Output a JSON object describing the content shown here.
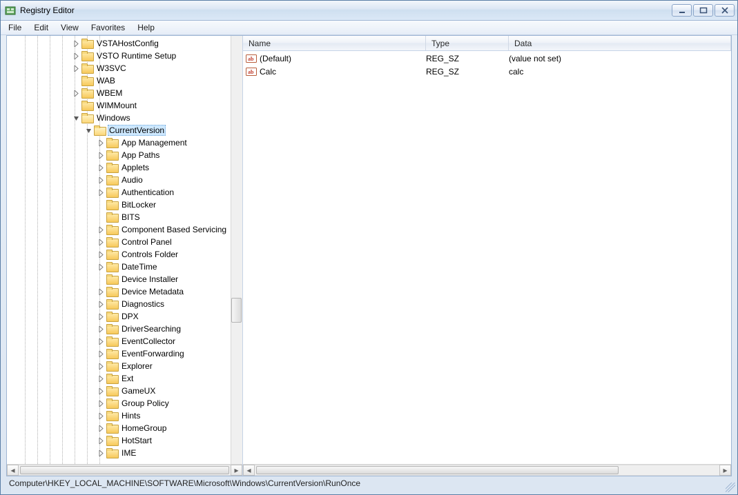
{
  "window": {
    "title": "Registry Editor"
  },
  "menu": {
    "file": "File",
    "edit": "Edit",
    "view": "View",
    "favorites": "Favorites",
    "help": "Help"
  },
  "columns": {
    "name": "Name",
    "type": "Type",
    "data": "Data"
  },
  "values": [
    {
      "name": "(Default)",
      "type": "REG_SZ",
      "data": "(value not set)"
    },
    {
      "name": "Calc",
      "type": "REG_SZ",
      "data": "calc"
    }
  ],
  "status": "Computer\\HKEY_LOCAL_MACHINE\\SOFTWARE\\Microsoft\\Windows\\CurrentVersion\\RunOnce",
  "tree": [
    {
      "d": 5,
      "t": "c",
      "label": "VSTAHostConfig"
    },
    {
      "d": 5,
      "t": "c",
      "label": "VSTO Runtime Setup"
    },
    {
      "d": 5,
      "t": "c",
      "label": "W3SVC"
    },
    {
      "d": 5,
      "t": "",
      "label": "WAB"
    },
    {
      "d": 5,
      "t": "c",
      "label": "WBEM"
    },
    {
      "d": 5,
      "t": "",
      "label": "WIMMount"
    },
    {
      "d": 5,
      "t": "o",
      "label": "Windows"
    },
    {
      "d": 6,
      "t": "o",
      "label": "CurrentVersion",
      "sel": true
    },
    {
      "d": 7,
      "t": "c",
      "label": "App Management"
    },
    {
      "d": 7,
      "t": "c",
      "label": "App Paths"
    },
    {
      "d": 7,
      "t": "c",
      "label": "Applets"
    },
    {
      "d": 7,
      "t": "c",
      "label": "Audio"
    },
    {
      "d": 7,
      "t": "c",
      "label": "Authentication"
    },
    {
      "d": 7,
      "t": "",
      "label": "BitLocker"
    },
    {
      "d": 7,
      "t": "",
      "label": "BITS"
    },
    {
      "d": 7,
      "t": "c",
      "label": "Component Based Servicing"
    },
    {
      "d": 7,
      "t": "c",
      "label": "Control Panel"
    },
    {
      "d": 7,
      "t": "c",
      "label": "Controls Folder"
    },
    {
      "d": 7,
      "t": "c",
      "label": "DateTime"
    },
    {
      "d": 7,
      "t": "",
      "label": "Device Installer"
    },
    {
      "d": 7,
      "t": "c",
      "label": "Device Metadata"
    },
    {
      "d": 7,
      "t": "c",
      "label": "Diagnostics"
    },
    {
      "d": 7,
      "t": "c",
      "label": "DPX"
    },
    {
      "d": 7,
      "t": "c",
      "label": "DriverSearching"
    },
    {
      "d": 7,
      "t": "c",
      "label": "EventCollector"
    },
    {
      "d": 7,
      "t": "c",
      "label": "EventForwarding"
    },
    {
      "d": 7,
      "t": "c",
      "label": "Explorer"
    },
    {
      "d": 7,
      "t": "c",
      "label": "Ext"
    },
    {
      "d": 7,
      "t": "c",
      "label": "GameUX"
    },
    {
      "d": 7,
      "t": "c",
      "label": "Group Policy"
    },
    {
      "d": 7,
      "t": "c",
      "label": "Hints"
    },
    {
      "d": 7,
      "t": "c",
      "label": "HomeGroup"
    },
    {
      "d": 7,
      "t": "c",
      "label": "HotStart"
    },
    {
      "d": 7,
      "t": "c",
      "label": "IME"
    }
  ]
}
